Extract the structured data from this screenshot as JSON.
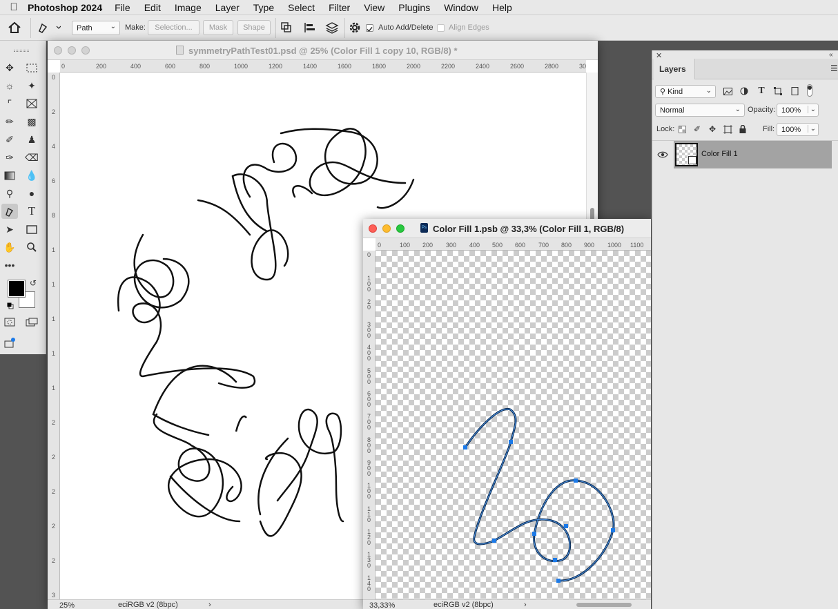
{
  "menubar": {
    "app_name": "Photoshop 2024",
    "items": [
      "File",
      "Edit",
      "Image",
      "Layer",
      "Type",
      "Select",
      "Filter",
      "View",
      "Plugins",
      "Window",
      "Help"
    ]
  },
  "options_bar": {
    "mode_value": "Path",
    "make_label": "Make:",
    "selection_label": "Selection...",
    "mask_label": "Mask",
    "shape_label": "Shape",
    "auto_add_label": "Auto Add/Delete",
    "align_edges_label": "Align Edges",
    "auto_add_checked": true
  },
  "doc1": {
    "title": "symmetryPathTest01.psd @ 25% (Color Fill 1 copy 10, RGB/8) *",
    "zoom": "25%",
    "profile": "eciRGB v2 (8bpc)",
    "ruler_h": [
      "0",
      "200",
      "400",
      "600",
      "800",
      "1000",
      "1200",
      "1400",
      "1600",
      "1800",
      "2000",
      "2200",
      "2400",
      "2600",
      "2800",
      "30"
    ],
    "ruler_v": [
      "0",
      "2",
      "4",
      "6",
      "8",
      "1",
      "1",
      "1",
      "1",
      "1",
      "2",
      "2",
      "2",
      "2",
      "2",
      "3"
    ]
  },
  "doc2": {
    "title": "Color Fill 1.psb @ 33,3% (Color Fill 1, RGB/8)",
    "zoom": "33,33%",
    "profile": "eciRGB v2 (8bpc)",
    "ruler_h": [
      "0",
      "100",
      "200",
      "300",
      "400",
      "500",
      "600",
      "700",
      "800",
      "900",
      "1000",
      "1100"
    ],
    "ruler_v": [
      "0",
      "1 0 0",
      "2 0",
      "3 0 0",
      "4 0 0",
      "5 0 0",
      "6 0 0",
      "7 0 0",
      "8 0 0",
      "9 0 0",
      "1 0 0",
      "1 1 0",
      "1 2 0",
      "1 3 0",
      "1 4 0"
    ]
  },
  "layers_panel": {
    "tab_label": "Layers",
    "filter_value": "Kind",
    "blend_mode": "Normal",
    "opacity_label": "Opacity:",
    "opacity_value": "100%",
    "lock_label": "Lock:",
    "fill_label": "Fill:",
    "fill_value": "100%",
    "layer_name": "Color Fill 1"
  },
  "colors": {
    "selected_layer": "#a3a3a3",
    "anchor": "#1c7ae8",
    "path": "#0c2d55"
  }
}
